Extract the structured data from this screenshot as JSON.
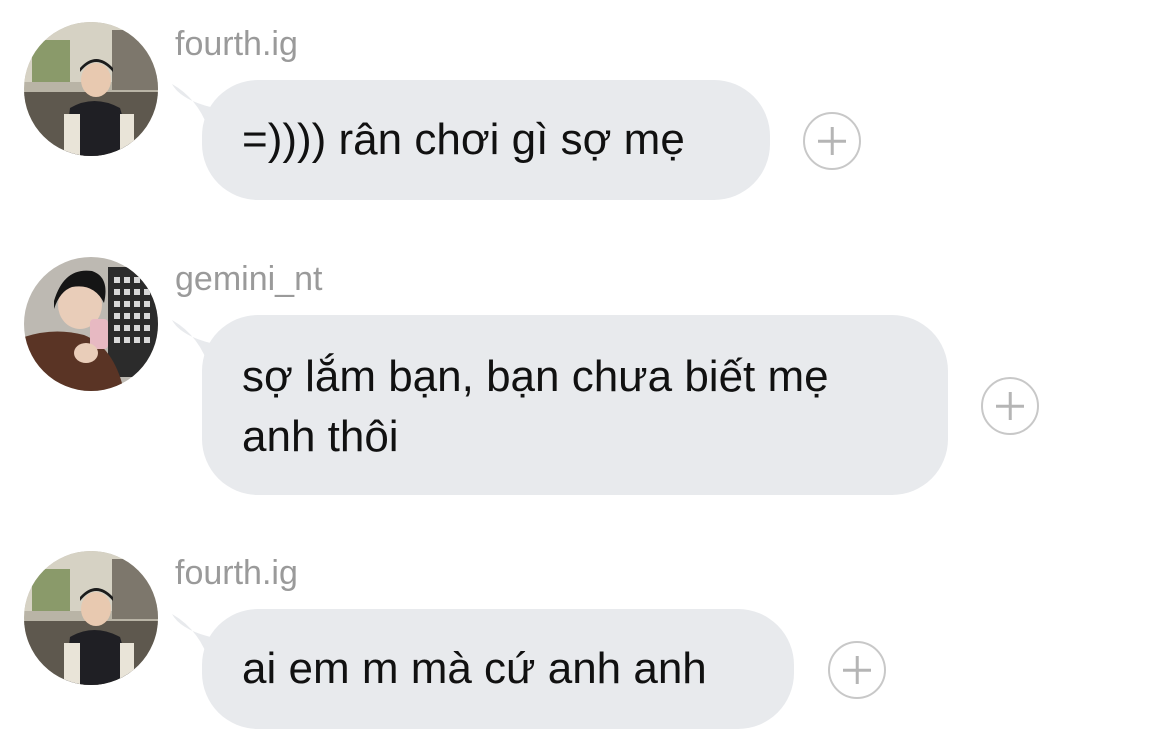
{
  "messages": [
    {
      "username": "fourth.ig",
      "text": "=)))) rân chơi gì sợ mẹ",
      "avatar_icon": "user-avatar-icon",
      "react_icon": "add-reaction-icon"
    },
    {
      "username": "gemini_nt",
      "text": "sợ lắm bạn, bạn chưa biết mẹ anh thôi",
      "avatar_icon": "user-avatar-icon",
      "react_icon": "add-reaction-icon"
    },
    {
      "username": "fourth.ig",
      "text": "ai em m mà cứ anh anh",
      "avatar_icon": "user-avatar-icon",
      "react_icon": "add-reaction-icon"
    }
  ],
  "colors": {
    "bubble": "#e8eaed",
    "username": "#9a9a9a",
    "text": "#111111",
    "react_border": "#c8c8c8"
  }
}
